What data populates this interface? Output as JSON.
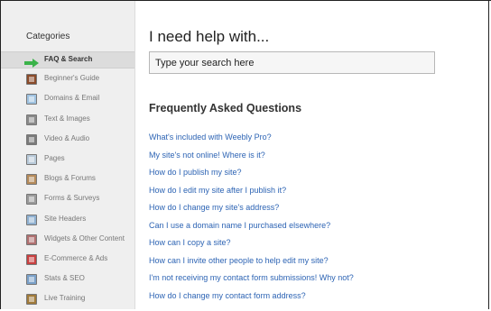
{
  "sidebar": {
    "title": "Categories",
    "items": [
      {
        "label": "FAQ & Search",
        "icon": "green-arrow-icon",
        "active": true,
        "color": "#3bb34a"
      },
      {
        "label": "Beginner's Guide",
        "icon": "book-icon",
        "active": false,
        "color": "#8a4b2a"
      },
      {
        "label": "Domains & Email",
        "icon": "globe-icon",
        "active": false,
        "color": "#9fc2e0"
      },
      {
        "label": "Text & Images",
        "icon": "text-image-icon",
        "active": false,
        "color": "#8a8a8a"
      },
      {
        "label": "Video & Audio",
        "icon": "video-icon",
        "active": false,
        "color": "#7b7b7b"
      },
      {
        "label": "Pages",
        "icon": "page-icon",
        "active": false,
        "color": "#b8c9d8"
      },
      {
        "label": "Blogs & Forums",
        "icon": "blog-icon",
        "active": false,
        "color": "#b48a5a"
      },
      {
        "label": "Forms & Surveys",
        "icon": "form-icon",
        "active": false,
        "color": "#9a9a9a"
      },
      {
        "label": "Site Headers",
        "icon": "header-icon",
        "active": false,
        "color": "#8fb0d0"
      },
      {
        "label": "Widgets & Other Content",
        "icon": "widget-icon",
        "active": false,
        "color": "#b07070"
      },
      {
        "label": "E-Commerce & Ads",
        "icon": "cart-icon",
        "active": false,
        "color": "#c84040"
      },
      {
        "label": "Stats & SEO",
        "icon": "chart-icon",
        "active": false,
        "color": "#7aa0c8"
      },
      {
        "label": "Live Training",
        "icon": "training-icon",
        "active": false,
        "color": "#a07a3a"
      }
    ]
  },
  "main": {
    "heading": "I need help with...",
    "search": {
      "placeholder": "Type your search here"
    },
    "faq_title": "Frequently Asked Questions",
    "faq": [
      "What's included with Weebly Pro?",
      "My site's not online! Where is it?",
      "How do I publish my site?",
      "How do I edit my site after I publish it?",
      "How do I change my site's address?",
      "Can I use a domain name I purchased elsewhere?",
      "How can I copy a site?",
      "How can I invite other people to help edit my site?",
      "I'm not receiving my contact form submissions!  Why not?",
      "How do I change my contact form address?"
    ]
  }
}
